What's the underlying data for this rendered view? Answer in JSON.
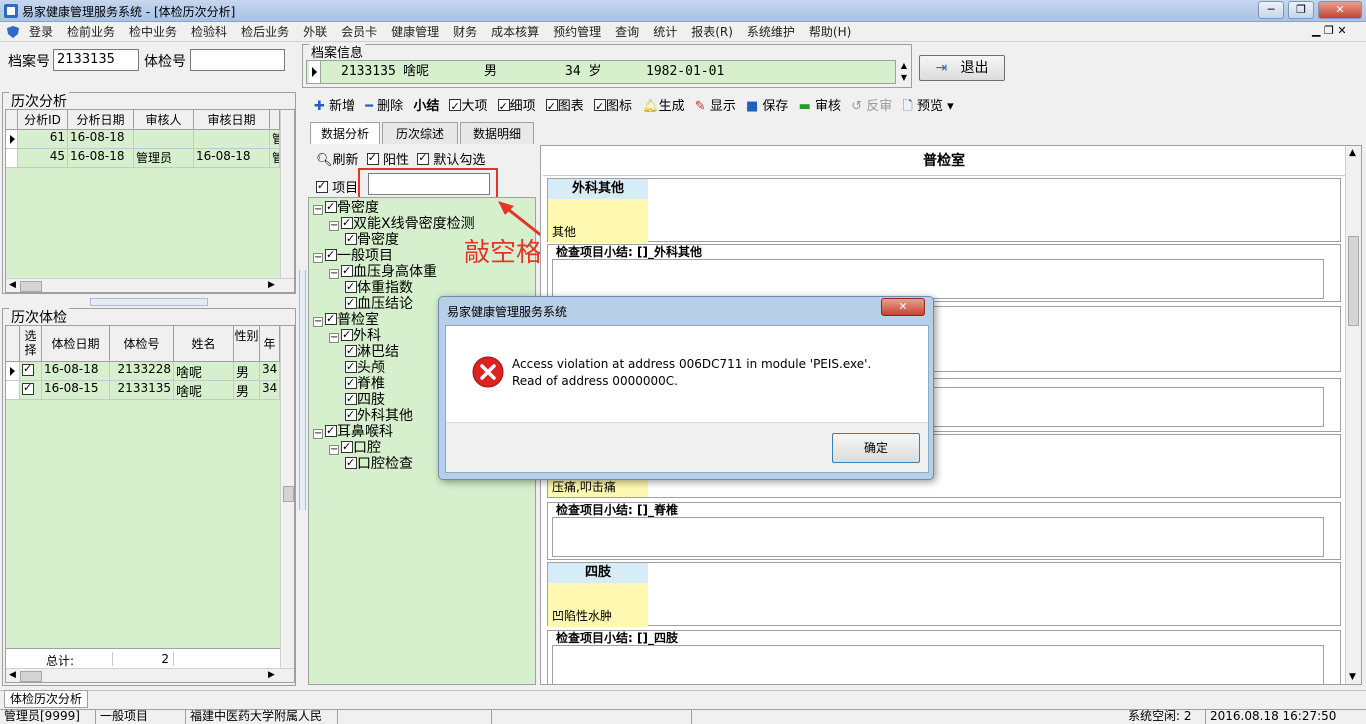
{
  "window": {
    "title": "易家健康管理服务系统 - [体检历次分析]"
  },
  "menu": [
    "登录",
    "检前业务",
    "检中业务",
    "检验科",
    "检后业务",
    "外联",
    "会员卡",
    "健康管理",
    "财务",
    "成本核算",
    "预约管理",
    "查询",
    "统计",
    "报表(R)",
    "系统维护",
    "帮助(H)"
  ],
  "search": {
    "archive_label": "档案号",
    "archive_value": "2133135",
    "exam_label": "体检号",
    "exam_value": ""
  },
  "archive_info": {
    "title": "档案信息",
    "id": "2133135",
    "name": "啥呢",
    "sex": "男",
    "age": "34 岁",
    "birth": "1982-01-01"
  },
  "exit_label": "退出",
  "history_analysis": {
    "title": "历次分析",
    "columns": [
      "分析ID",
      "分析日期",
      "审核人",
      "审核日期"
    ],
    "rows": [
      {
        "id": "61",
        "date": "16-08-18",
        "reviewer": "",
        "review_date": "",
        "extra": "管"
      },
      {
        "id": "45",
        "date": "16-08-18",
        "reviewer": "管理员",
        "review_date": "16-08-18",
        "extra": "管"
      }
    ]
  },
  "history_exams": {
    "title": "历次体检",
    "columns": [
      "选择",
      "体检日期",
      "体检号",
      "姓名",
      "性别",
      "年"
    ],
    "rows": [
      {
        "date": "16-08-18",
        "no": "2133228",
        "name": "啥呢",
        "sex": "男",
        "age": "34"
      },
      {
        "date": "16-08-15",
        "no": "2133135",
        "name": "啥呢",
        "sex": "男",
        "age": "34"
      }
    ],
    "total_label": "总计:",
    "total_value": "2"
  },
  "toolbar": {
    "add": "新增",
    "delete": "删除",
    "summary": "小结",
    "major": "大项",
    "detail": "细项",
    "chart": "图表",
    "icon": "图标",
    "generate": "生成",
    "show": "显示",
    "save": "保存",
    "review": "审核",
    "unreview": "反审",
    "preview": "预览"
  },
  "tabs": [
    "数据分析",
    "历次综述",
    "数据明细"
  ],
  "filter": {
    "refresh": "刷新",
    "positive": "阳性",
    "default_check": "默认勾选",
    "item_label": "项目",
    "item_value": ""
  },
  "annotation": "敲空格",
  "tree": [
    {
      "level": 0,
      "label": "骨密度"
    },
    {
      "level": 1,
      "label": "双能X线骨密度检测"
    },
    {
      "level": 2,
      "label": "骨密度"
    },
    {
      "level": 0,
      "label": "一般项目"
    },
    {
      "level": 1,
      "label": "血压身高体重"
    },
    {
      "level": 2,
      "label": "体重指数"
    },
    {
      "level": 2,
      "label": "血压结论"
    },
    {
      "level": 0,
      "label": "普检室"
    },
    {
      "level": 1,
      "label": "外科"
    },
    {
      "level": 2,
      "label": "淋巴结"
    },
    {
      "level": 2,
      "label": "头颅"
    },
    {
      "level": 2,
      "label": "脊椎"
    },
    {
      "level": 2,
      "label": "四肢"
    },
    {
      "level": 2,
      "label": "外科其他"
    },
    {
      "level": 0,
      "label": "耳鼻喉科"
    },
    {
      "level": 1,
      "label": "口腔"
    },
    {
      "level": 2,
      "label": "口腔检查"
    }
  ],
  "report": {
    "dept": "普检室",
    "sections": [
      {
        "item": "外科其他",
        "value": "其他",
        "summary": "检查项目小结: []_外科其他"
      },
      {
        "item": "",
        "value": "压痛,叩击痛",
        "summary": "检查项目小结: []_脊椎"
      },
      {
        "item": "四肢",
        "value": "凹陷性水肿",
        "summary": "检查项目小结: []_四肢"
      }
    ]
  },
  "dialog": {
    "title": "易家健康管理服务系统",
    "message": "Access violation at address 006DC711 in module 'PEIS.exe'. Read of address 0000000C.",
    "ok": "确定"
  },
  "bottom_tab": "体检历次分析",
  "statusbar": {
    "user": "管理员[9999]",
    "item": "一般项目",
    "org": "福建中医药大学附属人民",
    "idle": "系统空闲: 2",
    "time": "2016.08.18 16:27:50"
  }
}
